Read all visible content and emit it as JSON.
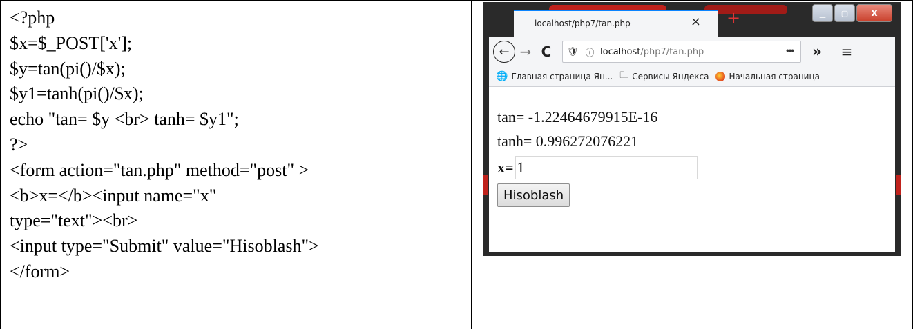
{
  "code": {
    "lines": [
      "<?php",
      "$x=$_POST['x'];",
      "$y=tan(pi()/$x);",
      "$y1=tanh(pi()/$x);",
      "echo \"tan= $y <br> tanh= $y1\";",
      "?>",
      "<form action=\"tan.php\" method=\"post\" >",
      "<b>x=</b><input name=\"x\"",
      "type=\"text\"><br>",
      "<input type=\"Submit\" value=\"Hisoblash\">",
      "</form>"
    ]
  },
  "browser": {
    "tab": {
      "title": "localhost/php7/tan.php",
      "close": "×"
    },
    "new_tab": "+",
    "window_controls": {
      "minimize": "▁",
      "maximize": "▢",
      "close": "x"
    },
    "nav": {
      "back": "←",
      "forward": "→",
      "reload": "C",
      "shield": "🛡",
      "info": "ⓘ",
      "url_host": "localhost",
      "url_path": "/php7/tan.php",
      "page_actions": "•••",
      "overflow": "»",
      "menu": "≡"
    },
    "bookmarks": [
      {
        "icon": "globe-icon",
        "glyph": "🌐",
        "label": "Главная страница Ян..."
      },
      {
        "icon": "folder-icon",
        "glyph": "🗀",
        "label": "Сервисы Яндекса"
      },
      {
        "icon": "firefox-icon",
        "glyph": "",
        "label": "Начальная страница"
      }
    ],
    "page": {
      "tan_line": "tan= -1.22464679915E-16",
      "tanh_line": "tanh= 0.996272076221",
      "x_label": "x=",
      "x_value": "1",
      "submit_label": "Hisoblash"
    }
  },
  "colors": {
    "tab_accent": "#0a84ff",
    "window_dark": "#2a2a2a",
    "window_red": "#c0221c"
  }
}
